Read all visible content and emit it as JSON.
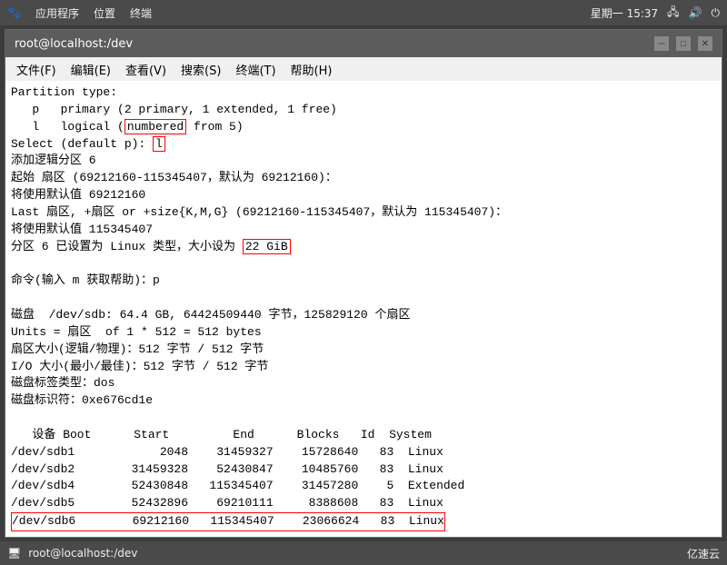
{
  "systemBar": {
    "apps": "应用程序",
    "position": "位置",
    "terminal": "终端",
    "datetime": "星期一 15:37",
    "icons": [
      "network-icon",
      "volume-icon",
      "power-icon"
    ]
  },
  "window": {
    "title": "root@localhost:/dev",
    "buttons": [
      "minimize",
      "maximize",
      "close"
    ]
  },
  "menuBar": {
    "items": [
      "文件(F)",
      "编辑(E)",
      "查看(V)",
      "搜索(S)",
      "终端(T)",
      "帮助(H)"
    ]
  },
  "terminal": {
    "lines": [
      "Partition type:",
      "   p   primary (2 primary, 1 extended, 1 free)",
      "   l   logical (numbered from 5)",
      "Select (default p): l",
      "添加逻辑分区 6",
      "起始 扇区 (69212160-115345407，默认为 69212160)：",
      "将使用默认值 69212160",
      "Last 扇区, +扇区 or +size{K,M,G} (69212160-115345407，默认为 115345407)：",
      "将使用默认值 115345407",
      "分区 6 已设置为 Linux 类型，大小设为 22 GiB",
      "",
      "命令(输入 m 获取帮助)：p",
      "",
      "磁盘  /dev/sdb: 64.4 GB, 64424509440 字节，125829120 个扇区",
      "Units = 扇区  of 1 * 512 = 512 bytes",
      "扇区大小(逻辑/物理)：512 字节 / 512 字节",
      "I/O 大小(最小/最佳)：512 字节 / 512 字节",
      "磁盘标签类型：dos",
      "磁盘标识符：0xe676cd1e",
      "",
      "   设备 Boot      Start         End      Blocks   Id  System",
      "/dev/sdb1            2048    31459327    15728640   83  Linux",
      "/dev/sdb2        31459328    52430847    10485760   83  Linux",
      "/dev/sdb4        52430848   115345407    31457280    5  Extended",
      "/dev/sdb5        52432896    69210111     8388608   83  Linux",
      "/dev/sdb6        69212160   115345407    23066624   83  Linux"
    ],
    "highlights": {
      "numbered": {
        "text": "numbered",
        "line": 2
      },
      "select_l": {
        "text": "l",
        "line": 3
      },
      "gib_22": {
        "text": "22 GiB",
        "line": 9
      },
      "sdb6_row": {
        "line": 25
      }
    }
  },
  "statusBar": {
    "user": "root@localhost:/dev",
    "brand": "亿速云"
  }
}
